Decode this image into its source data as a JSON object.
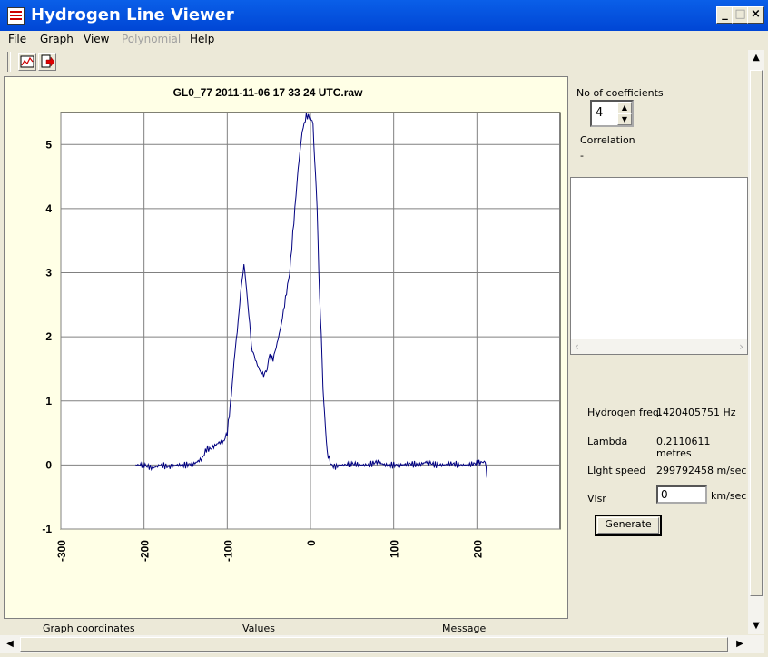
{
  "window": {
    "title": "Hydrogen Line Viewer"
  },
  "menu": {
    "items": [
      "File",
      "Graph",
      "View",
      "Polynomial",
      "Help"
    ]
  },
  "toolbar": {
    "icons": [
      "graph-icon",
      "export-icon"
    ]
  },
  "chart_data": {
    "type": "line",
    "title": "GL0_77 2011-11-06 17 33 24 UTC.raw",
    "xlabel": "",
    "ylabel": "",
    "xlim": [
      -300,
      300
    ],
    "ylim": [
      -1,
      5.5
    ],
    "xticks": [
      -300,
      -200,
      -100,
      0,
      100,
      200
    ],
    "yticks": [
      -1,
      0,
      1,
      2,
      3,
      4,
      5
    ],
    "grid": true,
    "line_color": "#000080",
    "series": [
      {
        "x": [
          -210,
          -200,
          -190,
          -180,
          -170,
          -160,
          -150,
          -140,
          -130,
          -125,
          -120,
          -115,
          -110,
          -105,
          -100,
          -95,
          -92,
          -88,
          -85,
          -82,
          -80,
          -78,
          -75,
          -72,
          -70,
          -65,
          -60,
          -55,
          -52,
          -50,
          -45,
          -40,
          -35,
          -30,
          -25,
          -20,
          -15,
          -10,
          -5,
          0,
          3,
          5,
          8,
          10,
          13,
          15,
          18,
          20,
          25,
          30,
          35,
          40,
          50,
          60,
          70,
          80,
          90,
          100,
          110,
          120,
          130,
          140,
          150,
          160,
          170,
          180,
          190,
          200,
          210,
          212
        ],
        "y": [
          0.0,
          0.0,
          -0.05,
          0.0,
          -0.03,
          0.0,
          0.0,
          0.02,
          0.1,
          0.25,
          0.25,
          0.3,
          0.35,
          0.35,
          0.5,
          1.1,
          1.6,
          2.1,
          2.5,
          2.95,
          3.1,
          2.9,
          2.5,
          2.0,
          1.8,
          1.6,
          1.45,
          1.4,
          1.5,
          1.7,
          1.65,
          1.9,
          2.2,
          2.6,
          3.0,
          3.8,
          4.6,
          5.2,
          5.45,
          5.42,
          5.3,
          4.8,
          4.0,
          3.0,
          2.0,
          1.2,
          0.6,
          0.2,
          0.0,
          -0.03,
          0.0,
          0.0,
          0.02,
          0.0,
          0.0,
          0.05,
          0.0,
          0.0,
          0.0,
          0.02,
          0.0,
          0.05,
          0.0,
          0.0,
          0.02,
          0.0,
          0.0,
          0.03,
          0.05,
          -0.2
        ]
      }
    ]
  },
  "right_panel": {
    "coeff_label": "No of coefficients",
    "coeff_value": "4",
    "correlation_label": "Correlation",
    "correlation_value": "-",
    "hydrogen_freq_label": "Hydrogen freq.",
    "hydrogen_freq_value": "1420405751 Hz",
    "lambda_label": "Lambda",
    "lambda_value": "0.2110611 metres",
    "light_speed_label": "LIght speed",
    "light_speed_value": "299792458 m/sec",
    "vlsr_label": "Vlsr",
    "vlsr_value": "0",
    "vlsr_unit": "km/sec",
    "generate_label": "Generate"
  },
  "status": {
    "graph_coordinates": "Graph coordinates",
    "values": "Values",
    "message": "Message"
  }
}
